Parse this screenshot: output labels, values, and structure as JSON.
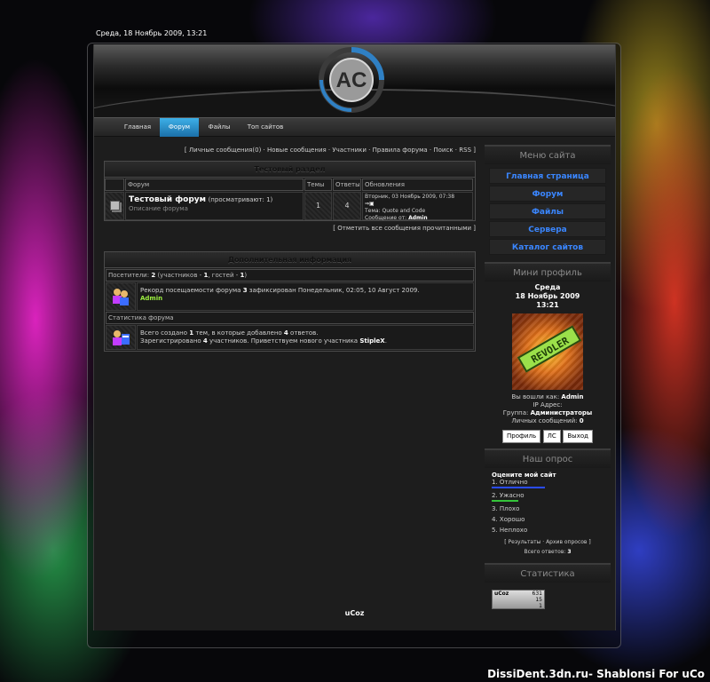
{
  "date_text": "Среда, 18 Ноябрь 2009, 13:21",
  "nav": {
    "items": [
      "Главная",
      "Форум",
      "Файлы",
      "Топ сайтов"
    ],
    "active": "Форум"
  },
  "forum": {
    "top_links": {
      "pm": "Личные сообщения(0)",
      "new": "Новые сообщения",
      "members": "Участники",
      "rules": "Правила форума",
      "search": "Поиск",
      "rss": "RSS"
    },
    "section_title": "Тестовый раздел",
    "columns": {
      "forum": "Форум",
      "topics": "Темы",
      "replies": "Ответы",
      "updates": "Обновления"
    },
    "row": {
      "name": "Тестовый форум",
      "viewing": "(просматривают: 1)",
      "description": "Описание форума",
      "topics": "1",
      "replies": "4",
      "last_date": "Вторник, 03 Ноябрь 2009, 07:38",
      "last_topic_label": "Тема:",
      "last_topic": "Quote and Code",
      "last_author_label": "Сообщение от:",
      "last_author": "Admin"
    },
    "mark_all": "Отметить все сообщения прочитанными"
  },
  "info": {
    "title": "Дополнительная информация",
    "visitors": {
      "label": "Посетители:",
      "total": "2",
      "members_label": "(участников -",
      "members": "1",
      "guests_label": ", гостей -",
      "guests": "1",
      "close": ")"
    },
    "record": {
      "text1": "Рекорд посещаемости форума",
      "count": "3",
      "text2": "зафиксирован Понедельник, 02:05, 10 Август 2009.",
      "user": "Admin"
    },
    "stats_head": "Статистика форума",
    "stats": {
      "t1": "Всего создано",
      "n1": "1",
      "t2": "тем, в которые добавлено",
      "n2": "4",
      "t3": "ответов.",
      "t4": "Зарегистрировано",
      "n3": "4",
      "t5": "участников. Приветствуем нового участника",
      "newest": "StipleX",
      "t6": "."
    }
  },
  "sidebar": {
    "menu_title": "Меню сайта",
    "menu": [
      "Главная страница",
      "Форум",
      "Файлы",
      "Сервера",
      "Каталог сайтов"
    ],
    "profile_title": "Мини профиль",
    "day": "Среда",
    "date": "18 Ноябрь 2009",
    "time": "13:21",
    "avatar_text": "REVOLER",
    "login_label": "Вы вошли как:",
    "login": "Admin",
    "ip_label": "IP Адрес:",
    "group_label": "Группа:",
    "group": "Администраторы",
    "pm_label": "Личных сообщений:",
    "pm": "0",
    "buttons": [
      "Профиль",
      "ЛС",
      "Выход"
    ],
    "poll_title": "Наш опрос",
    "poll_question": "Оцените мой сайт",
    "poll_options": [
      "1. Отлично",
      "2. Ужасно",
      "3. Плохо",
      "4. Хорошо",
      "5. Неплохо"
    ],
    "poll_results": "Результаты",
    "poll_archive": "Архив опросов",
    "poll_total_label": "Всего ответов:",
    "poll_total": "3",
    "stats_title": "Статистика",
    "counter": {
      "logo": "uCoz",
      "v1": "631",
      "v2": "15",
      "v3": "1"
    }
  },
  "footer": {
    "brand": "uCoz"
  },
  "watermark": "DissiDent.3dn.ru- Shablonsi For uCo",
  "colors": {
    "accent": "#3a86ff",
    "active_tab": "#2a8fd0",
    "green": "#9cf040"
  }
}
